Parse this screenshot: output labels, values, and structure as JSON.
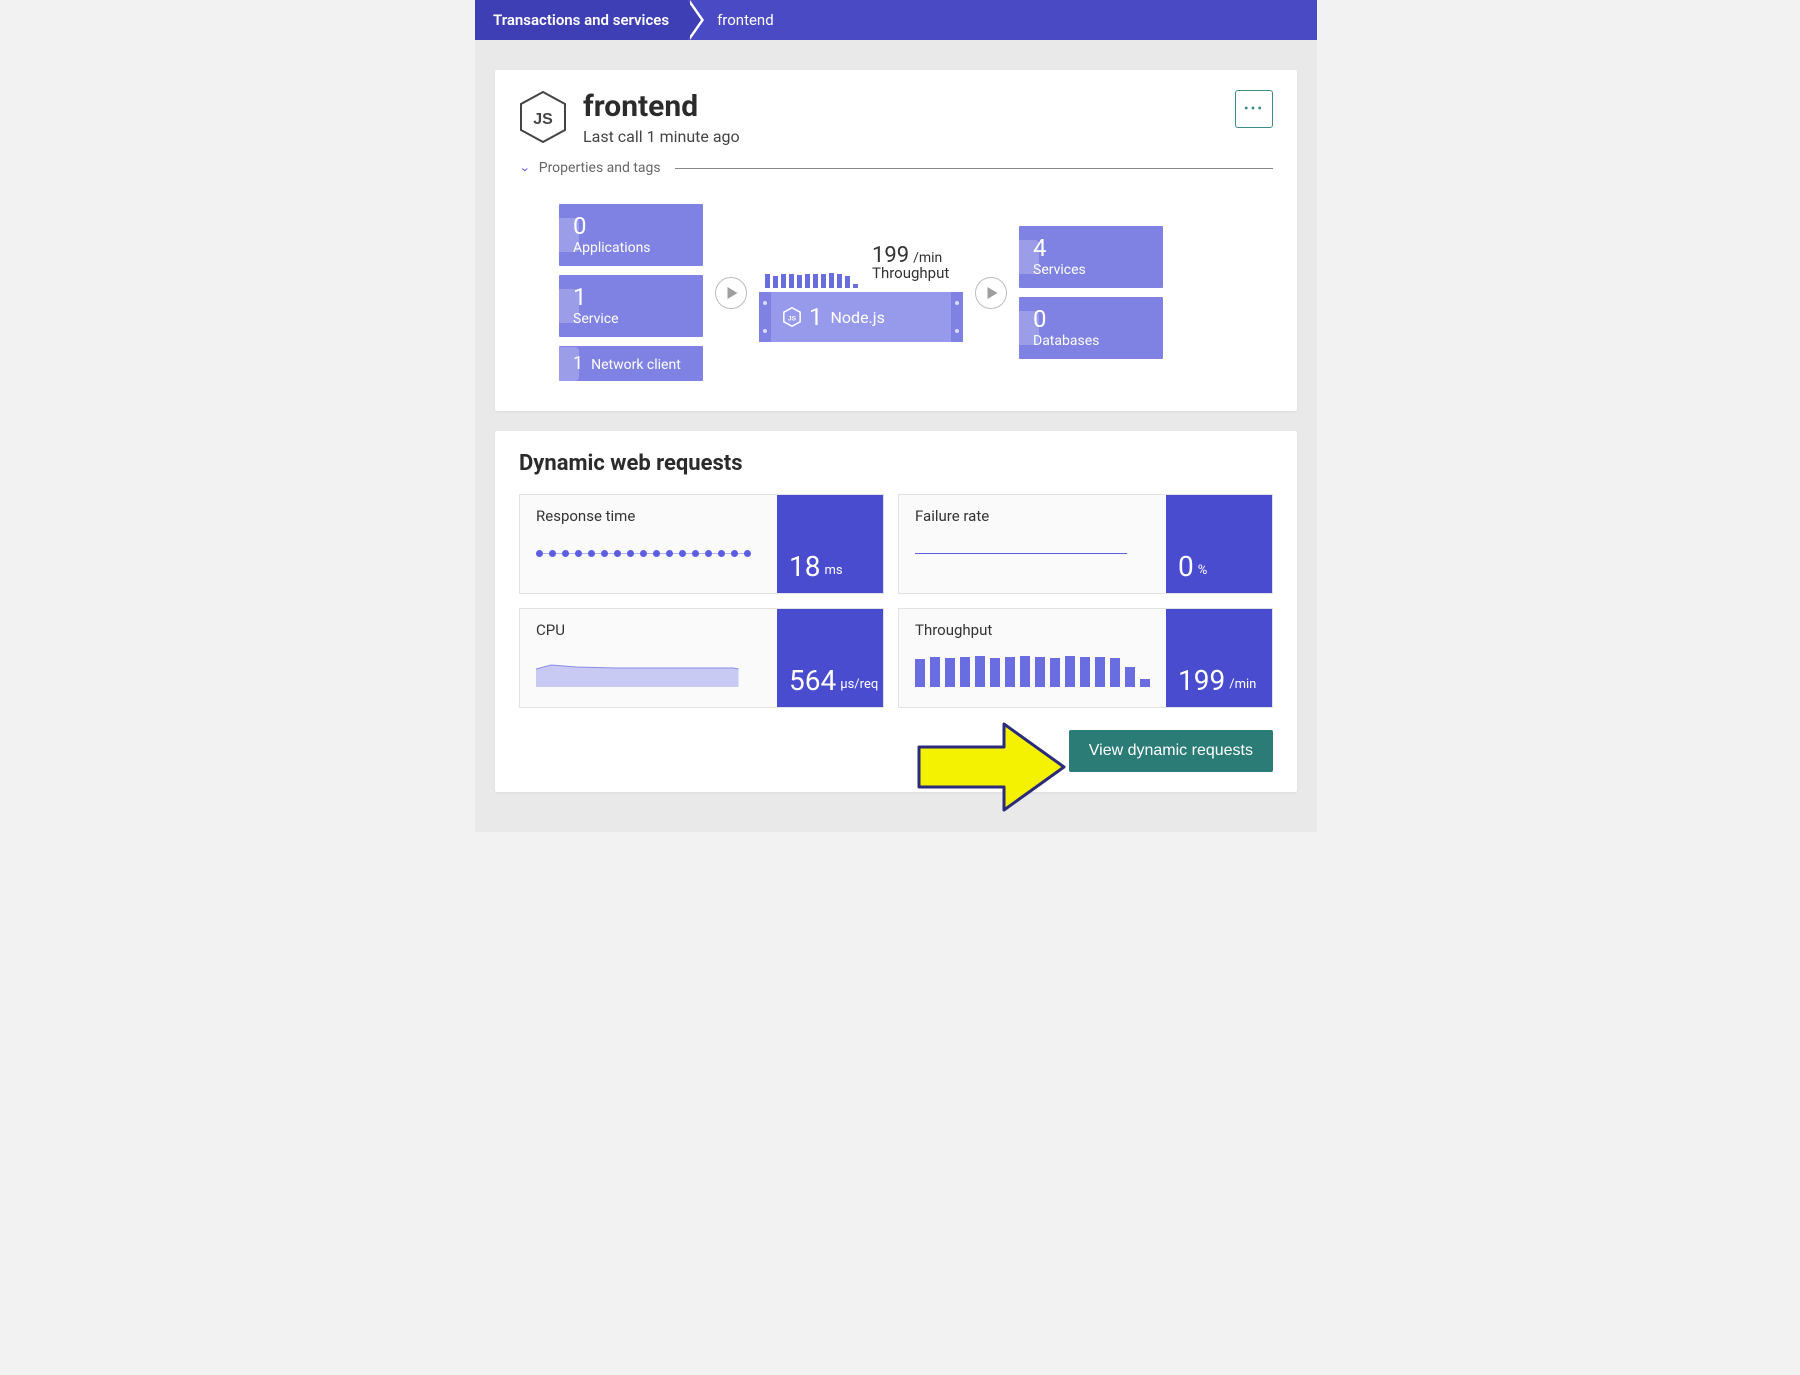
{
  "breadcrumb": {
    "root": "Transactions and services",
    "current": "frontend"
  },
  "header": {
    "title": "frontend",
    "last_call": "Last call 1 minute ago",
    "props_toggle": "Properties and tags",
    "tech": "Node.js"
  },
  "flow": {
    "left": [
      {
        "count": "0",
        "label": "Applications"
      },
      {
        "count": "1",
        "label": "Service"
      },
      {
        "count": "1",
        "label": "Network client"
      }
    ],
    "center": {
      "throughput_value": "199",
      "throughput_unit": "/min",
      "throughput_label": "Throughput",
      "node_count": "1",
      "node_label": "Node.js"
    },
    "right": [
      {
        "count": "4",
        "label": "Services"
      },
      {
        "count": "0",
        "label": "Databases"
      }
    ]
  },
  "dynamic": {
    "title": "Dynamic web requests",
    "metrics": [
      {
        "name": "Response time",
        "value": "18",
        "unit": "ms",
        "viz": "dots"
      },
      {
        "name": "Failure rate",
        "value": "0",
        "unit": "%",
        "viz": "line"
      },
      {
        "name": "CPU",
        "value": "564",
        "unit": "µs/req",
        "viz": "area"
      },
      {
        "name": "Throughput",
        "value": "199",
        "unit": "/min",
        "viz": "bars"
      }
    ],
    "cta": "View dynamic requests"
  },
  "chart_data": [
    {
      "type": "line",
      "name": "Response time",
      "values": [
        18,
        18,
        18,
        18,
        18,
        18,
        18,
        18,
        18,
        18,
        18,
        18,
        18,
        18,
        18,
        18,
        18
      ],
      "ylabel": "ms"
    },
    {
      "type": "line",
      "name": "Failure rate",
      "values": [
        0
      ],
      "ylabel": "%"
    },
    {
      "type": "area",
      "name": "CPU",
      "values": [
        560,
        580,
        575,
        570,
        568,
        566,
        565,
        564,
        564,
        564,
        563,
        560
      ],
      "ylabel": "µs/req"
    },
    {
      "type": "bar",
      "name": "Throughput",
      "values": [
        190,
        200,
        195,
        200,
        205,
        198,
        200,
        202,
        200,
        198,
        205,
        200,
        199,
        195,
        140,
        90
      ],
      "ylabel": "/min"
    },
    {
      "type": "bar",
      "name": "Flow throughput mini",
      "values": [
        14,
        12,
        14,
        14,
        13,
        14,
        14,
        14,
        15,
        14,
        12,
        4
      ],
      "ylabel": ""
    }
  ]
}
